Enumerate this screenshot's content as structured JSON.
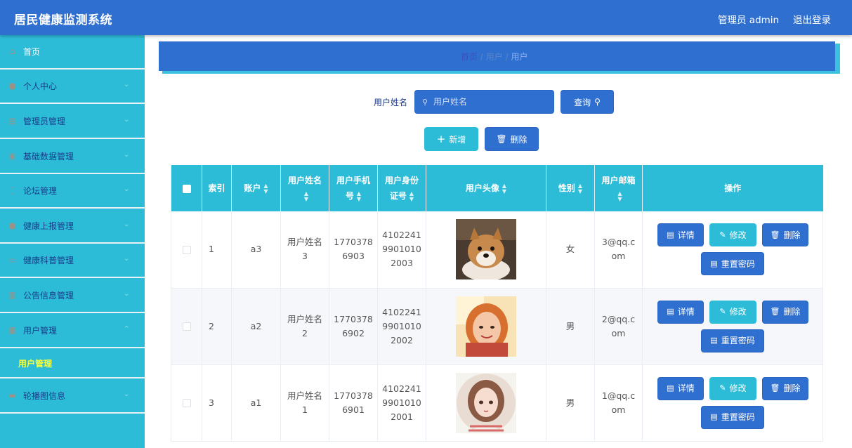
{
  "header": {
    "title": "居民健康监测系统",
    "admin": "管理员 admin",
    "logout": "退出登录"
  },
  "sidebar": {
    "items": [
      {
        "label": "首页",
        "icon": "home-icon"
      },
      {
        "label": "个人中心",
        "icon": "user-icon"
      },
      {
        "label": "管理员管理",
        "icon": "admin-icon"
      },
      {
        "label": "基础数据管理",
        "icon": "data-icon"
      },
      {
        "label": "论坛管理",
        "icon": "forum-icon"
      },
      {
        "label": "健康上报管理",
        "icon": "report-icon"
      },
      {
        "label": "健康科普管理",
        "icon": "science-icon"
      },
      {
        "label": "公告信息管理",
        "icon": "notice-icon"
      },
      {
        "label": "用户管理",
        "icon": "users-icon"
      },
      {
        "label": "轮播图信息",
        "icon": "carousel-icon"
      }
    ],
    "active_sub": "用户管理"
  },
  "breadcrumb": {
    "home": "首页",
    "sep1": "/",
    "mid": "用户",
    "sep2": "/",
    "current": "用户"
  },
  "search": {
    "label": "用户姓名",
    "placeholder": "用户姓名",
    "query_label": "查询"
  },
  "actions": {
    "add_label": "新增",
    "delete_label": "删除"
  },
  "table": {
    "headers": {
      "index": "索引",
      "account": "账户",
      "name_l1": "用户姓名",
      "phone_l1": "用户手机",
      "phone_l2": "号",
      "idcard_l1": "用户身份",
      "idcard_l2": "证号",
      "avatar": "用户头像",
      "gender": "性别",
      "email_l1": "用户邮箱",
      "ops": "操作"
    },
    "rows": [
      {
        "index": "1",
        "account": "a3",
        "name_l1": "用户姓名",
        "name_l2": "3",
        "phone_l1": "1770378",
        "phone_l2": "6903",
        "id_l1": "4102241",
        "id_l2": "9901010",
        "id_l3": "2003",
        "gender": "女",
        "email_l1": "3@qq.c",
        "email_l2": "om",
        "avatar": "dog"
      },
      {
        "index": "2",
        "account": "a2",
        "name_l1": "用户姓名",
        "name_l2": "2",
        "phone_l1": "1770378",
        "phone_l2": "6902",
        "id_l1": "4102241",
        "id_l2": "9901010",
        "id_l3": "2002",
        "gender": "男",
        "email_l1": "2@qq.c",
        "email_l2": "om",
        "avatar": "girl"
      },
      {
        "index": "3",
        "account": "a1",
        "name_l1": "用户姓名",
        "name_l2": "1",
        "phone_l1": "1770378",
        "phone_l2": "6901",
        "id_l1": "4102241",
        "id_l2": "9901010",
        "id_l3": "2001",
        "gender": "男",
        "email_l1": "1@qq.c",
        "email_l2": "om",
        "avatar": "drawing"
      }
    ],
    "op_labels": {
      "detail": "详情",
      "edit": "修改",
      "delete": "删除",
      "reset": "重置密码"
    }
  },
  "colors": {
    "primary": "#2f6fd0",
    "accent": "#2dbcd8",
    "active_sub": "#f5ff3b"
  }
}
